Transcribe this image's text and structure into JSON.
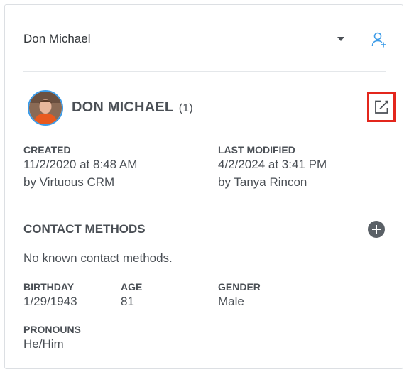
{
  "contact_select": {
    "value": "Don Michael"
  },
  "header": {
    "name": "DON MICHAEL",
    "count": "(1)"
  },
  "meta": {
    "created_label": "CREATED",
    "created_date": "11/2/2020 at 8:48 AM",
    "created_by": "by Virtuous CRM",
    "modified_label": "LAST MODIFIED",
    "modified_date": "4/2/2024 at 3:41 PM",
    "modified_by": "by Tanya Rincon"
  },
  "contact_methods": {
    "title": "CONTACT METHODS",
    "empty_text": "No known contact methods."
  },
  "details": {
    "birthday_label": "BIRTHDAY",
    "birthday": "1/29/1943",
    "age_label": "AGE",
    "age": "81",
    "gender_label": "GENDER",
    "gender": "Male",
    "pronouns_label": "PRONOUNS",
    "pronouns": "He/Him"
  },
  "icons": {
    "add_person": "add-person-icon",
    "edit": "edit-icon",
    "add_contact": "plus-circle-icon"
  },
  "colors": {
    "accent_blue": "#3b9be8",
    "highlight_red": "#e3261c",
    "text": "#4a4f55"
  }
}
